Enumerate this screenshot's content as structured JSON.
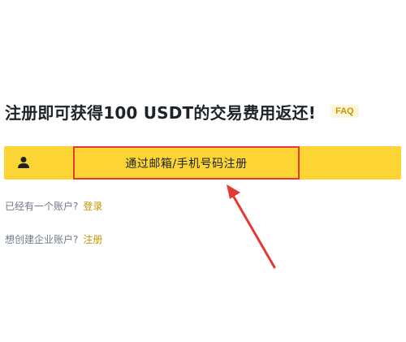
{
  "headline": {
    "text": "注册即可获得100 USDT的交易费用返还!",
    "faq_label": "FAQ"
  },
  "register_bar": {
    "icon": "user-icon",
    "button_label": "通过邮箱/手机号码注册"
  },
  "login_row": {
    "prompt": "已经有一个账户?",
    "link": "登录"
  },
  "enterprise_row": {
    "prompt": "想创建企业账户?",
    "link": "注册"
  },
  "annotation": {
    "highlight_color": "#e53935",
    "arrow_color": "#e53935"
  },
  "colors": {
    "accent": "#fcd535",
    "link": "#c99400",
    "text": "#1e2329",
    "muted": "#707a8a"
  }
}
